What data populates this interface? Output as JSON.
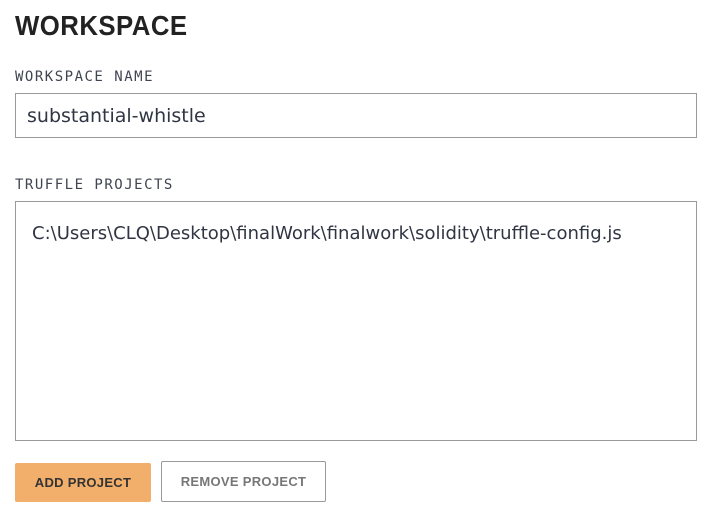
{
  "workspace": {
    "title": "WORKSPACE",
    "name_label": "WORKSPACE NAME",
    "name_value": "substantial-whistle",
    "projects_label": "TRUFFLE PROJECTS",
    "projects": [
      "C:\\Users\\CLQ\\Desktop\\finalWork\\finalwork\\solidity\\truffle-config.js"
    ]
  },
  "buttons": {
    "add_label": "ADD PROJECT",
    "remove_label": "REMOVE PROJECT"
  },
  "colors": {
    "accent": "#f1af6b",
    "border": "#9a9a9a",
    "text": "#2f3542"
  }
}
